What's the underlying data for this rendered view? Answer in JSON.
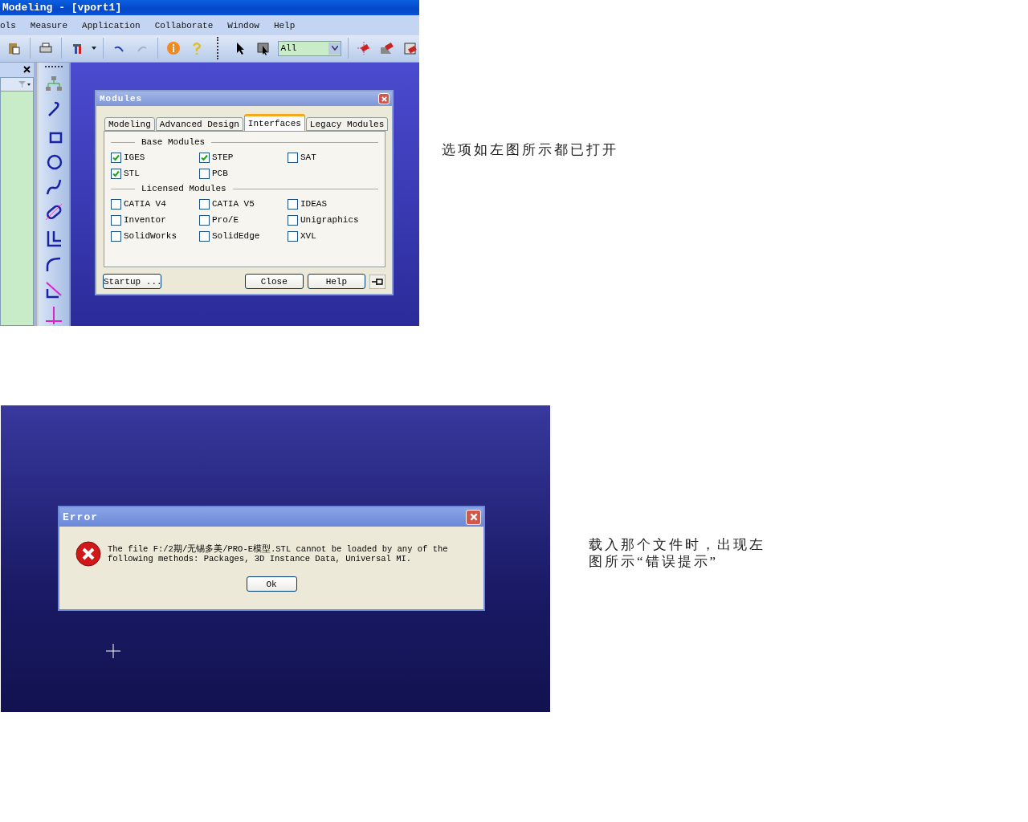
{
  "modules_screenshot": {
    "window": {
      "title": "Modeling - [vport1]"
    },
    "menu": [
      "ols",
      "Measure",
      "Application",
      "Collaborate",
      "Window",
      "Help"
    ],
    "toolbar": [
      {
        "kind": "paste",
        "disabled": false
      },
      {
        "kind": "print",
        "disabled": false
      },
      {
        "kind": "tools",
        "disabled": false
      },
      {
        "kind": "undo",
        "disabled": false
      },
      {
        "kind": "redo",
        "disabled": true
      },
      {
        "kind": "info",
        "disabled": false
      },
      {
        "kind": "help",
        "disabled": false
      },
      {
        "kind": "pointer",
        "disabled": false
      },
      {
        "kind": "filter",
        "disabled": false
      },
      {
        "kind": "combo",
        "value": "All"
      },
      {
        "kind": "snap",
        "disabled": false
      },
      {
        "kind": "erase",
        "disabled": false
      },
      {
        "kind": "box",
        "disabled": false
      }
    ],
    "side_tools": [
      {
        "kind": "tree"
      },
      {
        "kind": "arc"
      },
      {
        "kind": "rect"
      },
      {
        "kind": "circle"
      },
      {
        "kind": "spline"
      },
      {
        "kind": "slot"
      },
      {
        "kind": "corner"
      },
      {
        "kind": "fillet"
      },
      {
        "kind": "trim"
      },
      {
        "kind": "cross"
      }
    ],
    "dialog": {
      "title": "Modules",
      "tabs": [
        {
          "label": "Modeling",
          "selected": false
        },
        {
          "label": "Advanced Design",
          "selected": false
        },
        {
          "label": "Interfaces",
          "selected": true
        },
        {
          "label": "Legacy Modules",
          "selected": false
        }
      ],
      "groups": [
        {
          "title": "Base Modules",
          "options": [
            {
              "label": "IGES",
              "checked": true
            },
            {
              "label": "STEP",
              "checked": true
            },
            {
              "label": "SAT",
              "checked": false
            },
            {
              "label": "STL",
              "checked": true
            },
            {
              "label": "PCB",
              "checked": false
            }
          ]
        },
        {
          "title": "Licensed Modules",
          "options": [
            {
              "label": "CATIA V4",
              "checked": false
            },
            {
              "label": "CATIA V5",
              "checked": false
            },
            {
              "label": "IDEAS",
              "checked": false
            },
            {
              "label": "Inventor",
              "checked": false
            },
            {
              "label": "Pro/E",
              "checked": false
            },
            {
              "label": "Unigraphics",
              "checked": false
            },
            {
              "label": "SolidWorks",
              "checked": false
            },
            {
              "label": "SolidEdge",
              "checked": false
            },
            {
              "label": "XVL",
              "checked": false
            }
          ]
        }
      ],
      "buttons": [
        "Startup ...",
        "Close",
        "Help"
      ]
    }
  },
  "modules_note": "选项如左图所示都已打开",
  "error_screenshot": {
    "dialog": {
      "title": "Error",
      "message": "The file F:/2期/无锡多美/PRO-E模型.STL cannot be loaded by any of the following methods:  Packages, 3D Instance Data, Universal MI.",
      "button": "Ok"
    }
  },
  "error_note": "载入那个文件时，出现左图所示“错误提示”"
}
